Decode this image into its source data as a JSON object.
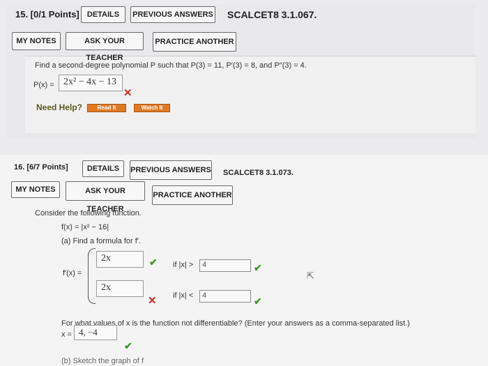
{
  "q15": {
    "points": "15. [0/1 Points]",
    "details": "DETAILS",
    "previous": "PREVIOUS ANSWERS",
    "code": "SCALCET8 3.1.067.",
    "my_notes": "MY NOTES",
    "ask_teacher": "ASK YOUR TEACHER",
    "practice": "PRACTICE ANOTHER",
    "prompt": "Find a second-degree polynomial P such that P(3) = 11, P′(3) = 8, and P″(3) = 4.",
    "px_label": "P(x) =",
    "answer": "2x² − 4x − 13",
    "need_help": "Need Help?",
    "read_it": "Read It",
    "watch_it": "Watch It"
  },
  "q16": {
    "points": "16. [6/7 Points]",
    "details": "DETAILS",
    "previous": "PREVIOUS ANSWERS",
    "code": "SCALCET8 3.1.073.",
    "my_notes": "MY NOTES",
    "ask_teacher": "ASK YOUR TEACHER",
    "practice": "PRACTICE ANOTHER",
    "intro": "Consider the following function.",
    "fx": "f(x) = |x² − 16|",
    "part_a": "(a) Find a formula for f′.",
    "fprime_label": "f′(x) =",
    "ans1": "2x",
    "cond1": "if |x| >",
    "cond1_val": "4",
    "ans2": "2x",
    "cond2": "if |x| <",
    "cond2_val": "4",
    "not_diff_q": "For what values of x is the function not differentiable? (Enter your answers as a comma-separated list.)",
    "x_label": "x =",
    "not_diff_ans": "4, −4",
    "part_b": "(b) Sketch the graph of f"
  }
}
